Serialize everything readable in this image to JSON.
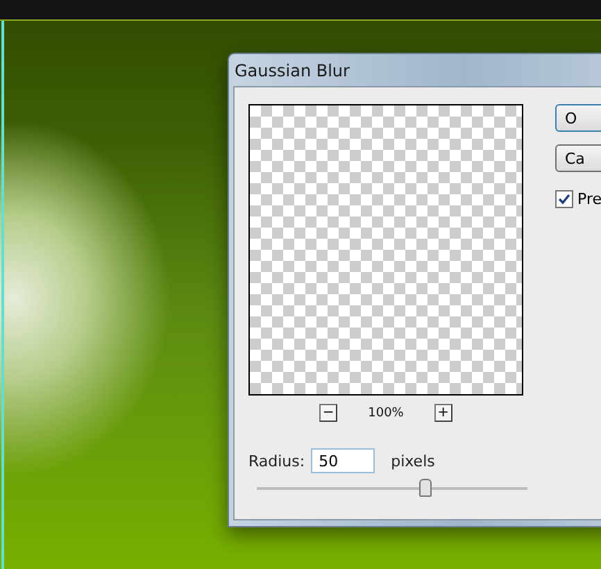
{
  "dialog": {
    "title": "Gaussian Blur",
    "zoom": {
      "minus": "−",
      "percent": "100%",
      "plus": "+"
    },
    "radius": {
      "label": "Radius:",
      "value": "50",
      "unit": "pixels"
    },
    "slider": {
      "level": 0.62
    },
    "buttons": [
      "O",
      "Ca"
    ],
    "preview": {
      "label": "Pre",
      "checked": true
    }
  }
}
